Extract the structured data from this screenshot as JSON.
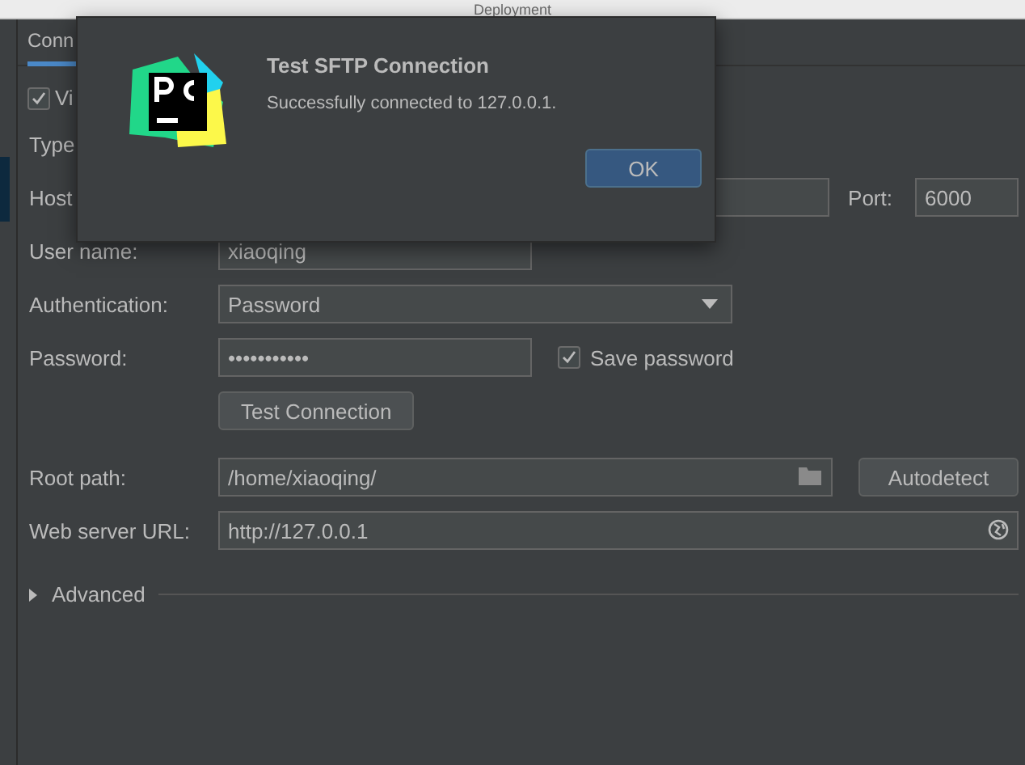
{
  "window": {
    "title": "Deployment"
  },
  "tabs": [
    {
      "label": "Conn",
      "selected": true
    }
  ],
  "visible_only": {
    "label": "Vi",
    "checked": true
  },
  "type": {
    "label": "Type"
  },
  "host": {
    "label": "Host",
    "port_label": "Port:",
    "port": "6000"
  },
  "user_name": {
    "label": "User name:",
    "value": "xiaoqing"
  },
  "authentication": {
    "label": "Authentication:",
    "value": "Password"
  },
  "password": {
    "label": "Password:",
    "value": "•••••••••••",
    "save_label": "Save password",
    "save_checked": true
  },
  "test_button": "Test Connection",
  "root_path": {
    "label": "Root path:",
    "value": "/home/xiaoqing/",
    "button": "Autodetect"
  },
  "web_server_url": {
    "label": "Web server URL:",
    "value": "http://127.0.0.1"
  },
  "advanced": {
    "label": "Advanced",
    "expanded": false
  },
  "dialog": {
    "title": "Test SFTP Connection",
    "message": "Successfully connected to 127.0.0.1.",
    "button": "OK"
  }
}
